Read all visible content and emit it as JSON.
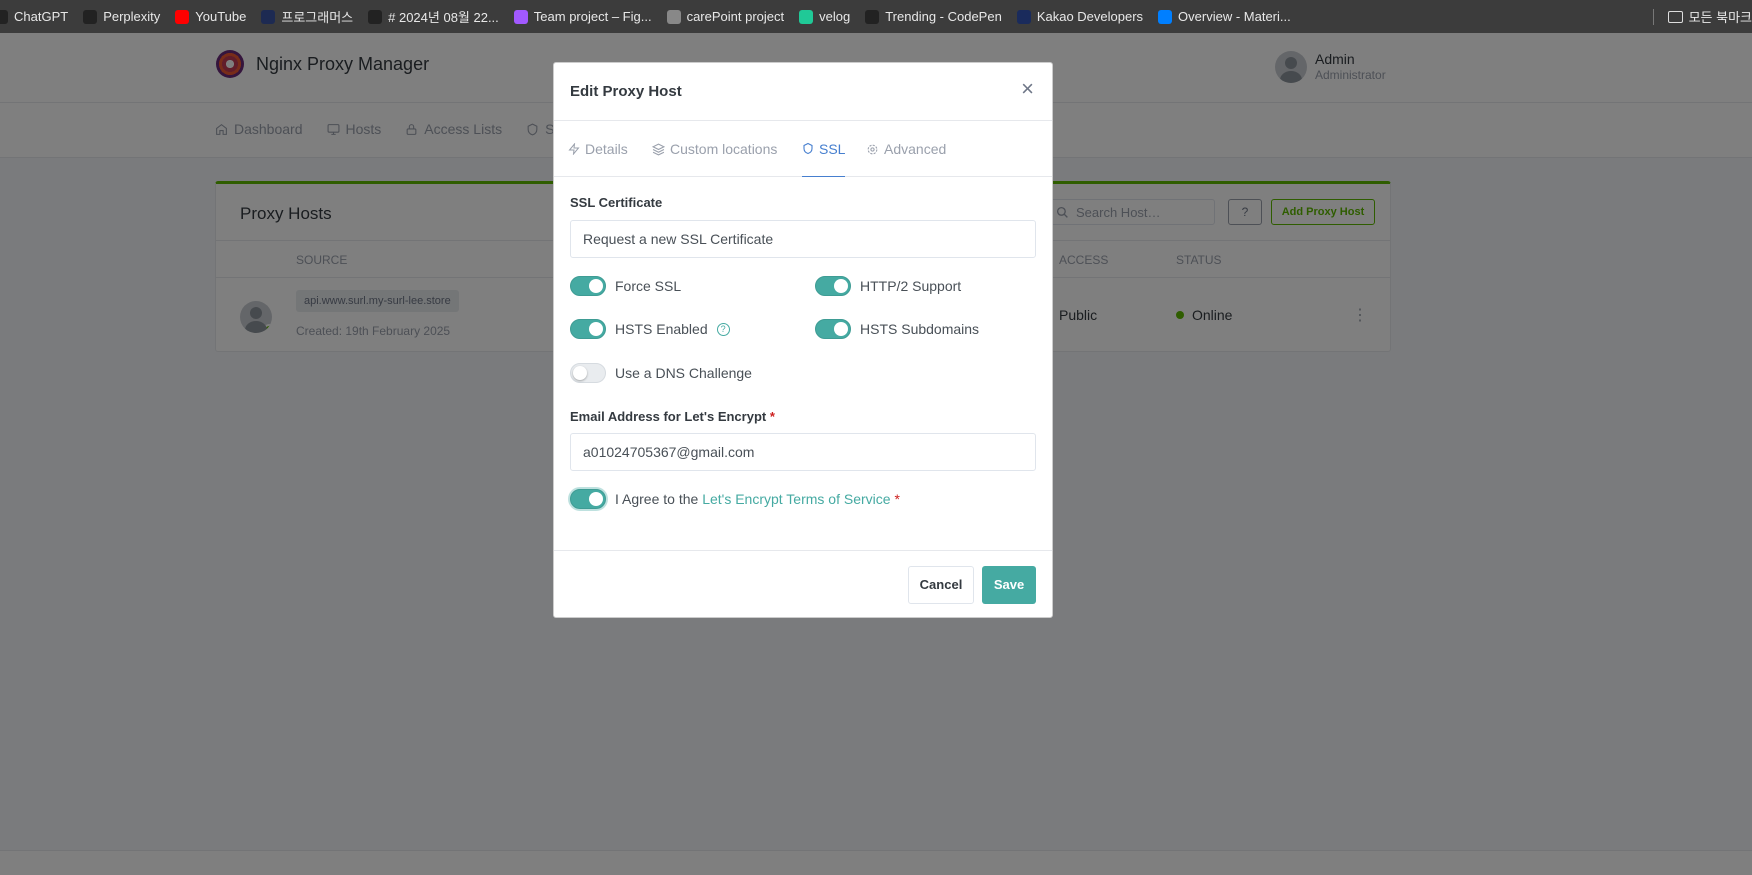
{
  "bookmarks": {
    "items": [
      {
        "label": "ChatGPT",
        "icon": "chatgpt-icon",
        "color": "#222222"
      },
      {
        "label": "Perplexity",
        "icon": "perplexity-icon",
        "color": "#222222"
      },
      {
        "label": "YouTube",
        "icon": "youtube-icon",
        "color": "#ff0000"
      },
      {
        "label": "프로그래머스",
        "icon": "programmers-icon",
        "color": "#1d2a52"
      },
      {
        "label": "# 2024년 08월 22...",
        "icon": "triangle-icon",
        "color": "#222222"
      },
      {
        "label": "Team project – Fig...",
        "icon": "figma-icon",
        "color": "#a259ff"
      },
      {
        "label": "carePoint project",
        "icon": "carepoint-icon",
        "color": "#888888"
      },
      {
        "label": "velog",
        "icon": "velog-icon",
        "color": "#20c997"
      },
      {
        "label": "Trending - CodePen",
        "icon": "codepen-icon",
        "color": "#222222"
      },
      {
        "label": "Kakao Developers",
        "icon": "kakao-icon",
        "color": "#1a2b5c"
      },
      {
        "label": "Overview - Materi...",
        "icon": "mui-icon",
        "color": "#007fff"
      }
    ],
    "folder_label": "모든 북마크"
  },
  "app": {
    "brand_title": "Nginx Proxy Manager",
    "user_name": "Admin",
    "user_role": "Administrator",
    "nav": {
      "dashboard": "Dashboard",
      "hosts": "Hosts",
      "access_lists": "Access Lists",
      "ssl": "SSL"
    },
    "card": {
      "title": "Proxy Hosts",
      "search_placeholder": "Search Host…",
      "help_label": "?",
      "add_label": "Add Proxy Host",
      "columns": {
        "source": "SOURCE",
        "access": "ACCESS",
        "status": "STATUS"
      },
      "row": {
        "source": "api.www.surl.my-surl-lee.store",
        "created": "Created: 19th February 2025",
        "access": "Public",
        "status": "Online"
      }
    }
  },
  "modal": {
    "title": "Edit Proxy Host",
    "close_glyph": "×",
    "tabs": {
      "details": "Details",
      "custom_locations": "Custom locations",
      "ssl": "SSL",
      "advanced": "Advanced"
    },
    "ssl_label": "SSL Certificate",
    "ssl_value": "Request a new SSL Certificate",
    "toggles": {
      "force_ssl": {
        "label": "Force SSL",
        "on": true
      },
      "http2": {
        "label": "HTTP/2 Support",
        "on": true
      },
      "hsts": {
        "label": "HSTS Enabled",
        "on": true
      },
      "hsts_sub": {
        "label": "HSTS Subdomains",
        "on": true
      },
      "dns": {
        "label": "Use a DNS Challenge",
        "on": false
      }
    },
    "email_label": "Email Address for Let's Encrypt",
    "required_mark": "*",
    "email_value": "a01024705367@gmail.com",
    "agree_prefix": "I Agree to the",
    "agree_link": "Let's Encrypt Terms of Service",
    "cancel_label": "Cancel",
    "save_label": "Save"
  },
  "colors": {
    "accent_teal": "#45aaa2",
    "tab_active": "#467fcf",
    "online_green": "#5eba00"
  }
}
